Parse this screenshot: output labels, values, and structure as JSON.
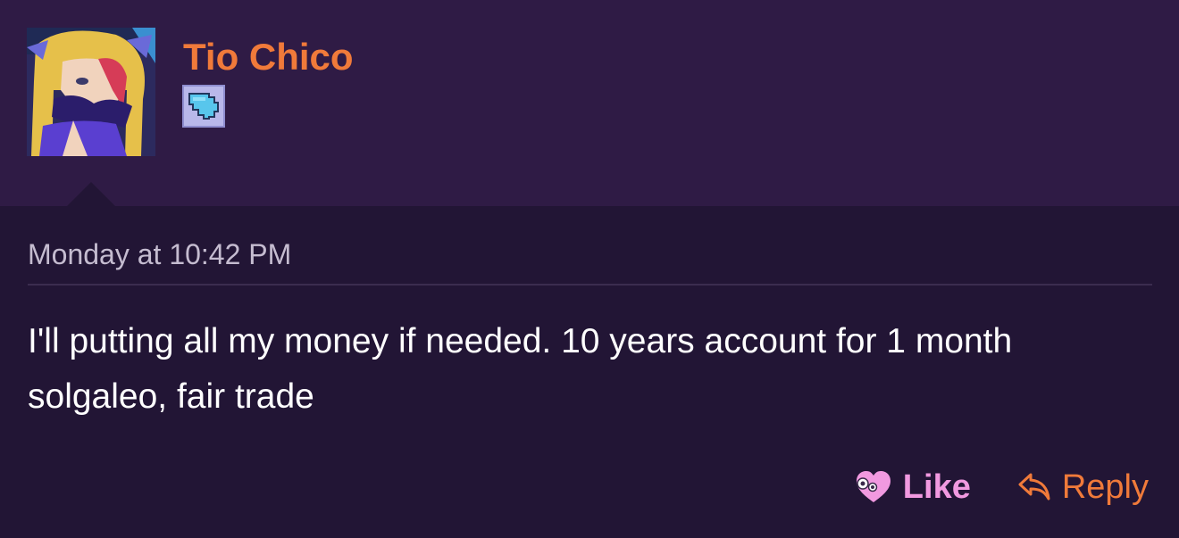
{
  "user": {
    "name": "Tio Chico",
    "name_color": "#f07a3a",
    "avatar_icon": "anime-character-avatar",
    "badge_icon": "pixel-shield-badge"
  },
  "post": {
    "timestamp": "Monday at 10:42 PM",
    "text": "I'll putting all my money if needed. 10 years account for 1 month solgaleo, fair trade"
  },
  "actions": {
    "like_label": "Like",
    "like_color": "#f199e0",
    "like_icon": "heart-face-icon",
    "reply_label": "Reply",
    "reply_color": "#f07a3a",
    "reply_icon": "reply-arrow-icon"
  }
}
